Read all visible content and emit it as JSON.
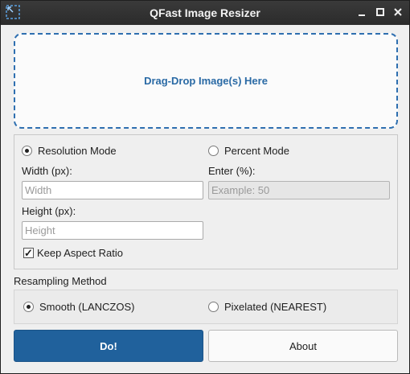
{
  "window": {
    "title": "QFast Image Resizer",
    "icon": "resize-app-icon"
  },
  "dropzone": {
    "label": "Drag-Drop Image(s) Here"
  },
  "mode": {
    "resolution_label": "Resolution Mode",
    "percent_label": "Percent Mode",
    "selected": "resolution"
  },
  "fields": {
    "width_label": "Width (px):",
    "width_placeholder": "Width",
    "height_label": "Height (px):",
    "height_placeholder": "Height",
    "percent_label": "Enter (%):",
    "percent_placeholder": "Example: 50"
  },
  "aspect": {
    "label": "Keep Aspect Ratio",
    "checked": true,
    "check_glyph": "✓"
  },
  "resampling": {
    "heading": "Resampling Method",
    "smooth_label": "Smooth (LANCZOS)",
    "pixelated_label": "Pixelated (NEAREST)",
    "selected": "smooth"
  },
  "actions": {
    "do_label": "Do!",
    "about_label": "About"
  },
  "colors": {
    "accent": "#20619c",
    "dropzone_border": "#2e6fb0",
    "titlebar": "#2b2b2b"
  }
}
